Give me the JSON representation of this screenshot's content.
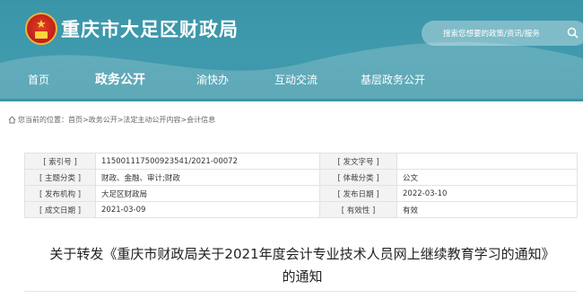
{
  "site": {
    "title": "重庆市大足区财政局"
  },
  "search": {
    "placeholder": "搜索您想要的政策/资讯/服务"
  },
  "nav": {
    "items": [
      "首页",
      "政务公开",
      "渝快办",
      "互动交流",
      "基层政务公开"
    ],
    "active_index": 1
  },
  "breadcrumb": {
    "prefix": "您当前的位置：",
    "path": "首页>政务公开>法定主动公开内容>会计信息"
  },
  "meta": {
    "rows": [
      {
        "k1": "[ 索引号 ]",
        "v1": "115001117500923541/2021-00072",
        "k2": "[ 发文字号 ]",
        "v2": ""
      },
      {
        "k1": "[ 主题分类 ]",
        "v1": "财政、金融、审计;财政",
        "k2": "[ 体裁分类 ]",
        "v2": "公文"
      },
      {
        "k1": "[ 发布机构 ]",
        "v1": "大足区财政局",
        "k2": "[ 发布日期 ]",
        "v2": "2022-03-10"
      },
      {
        "k1": "[ 成文日期 ]",
        "v1": "2021-03-09",
        "k2": "[ 有效性 ]",
        "v2": "有效"
      }
    ]
  },
  "document": {
    "title_line1": "关于转发《重庆市财政局关于2021年度会计专业技术人员网上继续教育学习的通知》",
    "title_line2": "的通知"
  },
  "colors": {
    "header": "#3c97aa",
    "label_bg": "#f3f3f3",
    "border": "#e2e2e2"
  },
  "icons": [
    "national-emblem-icon",
    "search-icon",
    "home-icon"
  ]
}
